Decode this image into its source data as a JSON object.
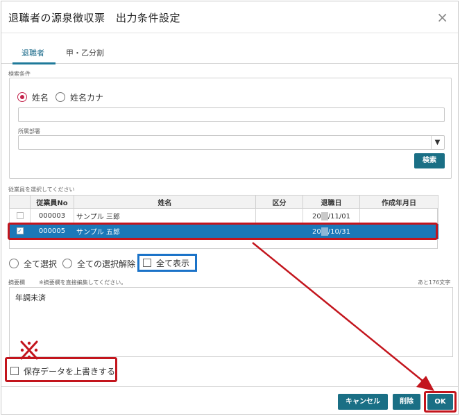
{
  "dialog": {
    "title": "退職者の源泉徴収票　出力条件設定",
    "close_icon": "×"
  },
  "tabs": [
    {
      "label": "退職者",
      "active": true
    },
    {
      "label": "甲・乙分割",
      "active": false
    }
  ],
  "search": {
    "section_label": "検索条件",
    "radio_name": "姓名",
    "radio_kana": "姓名カナ",
    "name_value": "",
    "dept_label": "所属部署",
    "dept_value": "",
    "select_arrow": "▼",
    "search_button": "検索"
  },
  "employees": {
    "section_label": "従業員を選択してください",
    "columns": [
      "従業員No",
      "姓名",
      "区分",
      "退職日",
      "作成年月日"
    ],
    "rows": [
      {
        "no": "000003",
        "name": "サンプル 三郎",
        "kubun": "",
        "date_prefix": "20",
        "date_suffix": "/11/01",
        "created": "",
        "selected": false
      },
      {
        "no": "000005",
        "name": "サンプル 五郎",
        "kubun": "",
        "date_prefix": "20",
        "date_suffix": "/10/31",
        "created": "",
        "selected": true
      }
    ]
  },
  "selection": {
    "select_all": "全て選択",
    "deselect_all": "全ての選択解除",
    "show_all": "全て表示"
  },
  "memo": {
    "label": "摘要欄",
    "hint": "※摘要欄を直接編集してください。",
    "remaining": "あと176文字",
    "text": "年調未済"
  },
  "annotation": {
    "note_mark": "※"
  },
  "overwrite": {
    "label": "保存データを上書きする"
  },
  "footer": {
    "cancel": "キャンセル",
    "delete": "削除",
    "ok": "OK"
  },
  "colors": {
    "accent": "#1a6f85",
    "selected_row": "#1b78b8",
    "annotation_red": "#c3151d",
    "annotation_blue": "#1b73c8",
    "radio_checked": "#c4244c"
  }
}
